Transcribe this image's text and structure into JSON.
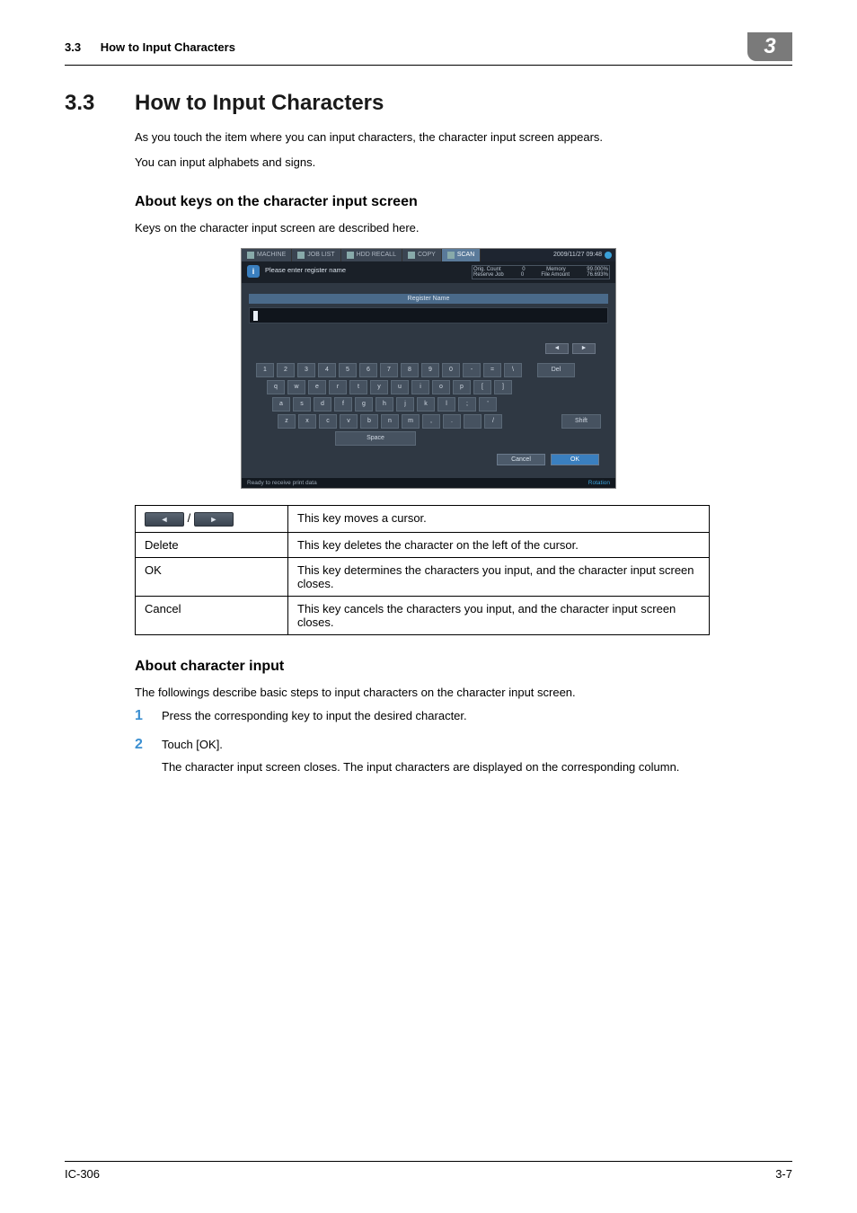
{
  "header": {
    "section_num": "3.3",
    "section_title": "How to Input Characters",
    "chapter_num": "3"
  },
  "heading": {
    "num": "3.3",
    "title": "How to Input Characters"
  },
  "intro": {
    "p1": "As you touch the item where you can input characters, the character input screen appears.",
    "p2": "You can input alphabets and signs."
  },
  "sub1": {
    "title": "About keys on the character input screen",
    "p1": "Keys on the character input screen are described here."
  },
  "device": {
    "tabs": {
      "machine": "MACHINE",
      "joblist": "JOB LIST",
      "hddrecall": "HDD RECALL",
      "copy": "COPY",
      "scan": "SCAN"
    },
    "datetime": "2009/11/27 09:48",
    "message": "Please enter register name",
    "status": {
      "orig_count_label": "Orig. Count",
      "orig_count_value": "0",
      "memory_label": "Memory",
      "memory_value": "99.000%",
      "reserve_label": "Reserve Job",
      "reserve_value": "0",
      "file_amount_label": "File Amount",
      "file_amount_value": "76.693%"
    },
    "field_title": "Register Name",
    "arrow_left": "◄",
    "arrow_right": "►",
    "row1": [
      "1",
      "2",
      "3",
      "4",
      "5",
      "6",
      "7",
      "8",
      "9",
      "0",
      "-",
      "=",
      "\\"
    ],
    "del_label": "Del",
    "row2": [
      "q",
      "w",
      "e",
      "r",
      "t",
      "y",
      "u",
      "i",
      "o",
      "p",
      "[",
      "]"
    ],
    "row3": [
      "a",
      "s",
      "d",
      "f",
      "g",
      "h",
      "j",
      "k",
      "l",
      ";",
      "'"
    ],
    "row4": [
      "z",
      "x",
      "c",
      "v",
      "b",
      "n",
      "m",
      ",",
      ".",
      "",
      "/"
    ],
    "shift_label": "Shift",
    "space_label": "Space",
    "cancel_label": "Cancel",
    "ok_label": "OK",
    "statusbar_left": "Ready to receive print data",
    "statusbar_right": "Rotation"
  },
  "key_table": {
    "r0": {
      "left_a": "◄",
      "left_sep": "/",
      "left_b": "►",
      "desc": "This key moves a cursor."
    },
    "r1": {
      "label": "Delete",
      "desc": "This key deletes the character on the left of the cursor."
    },
    "r2": {
      "label": "OK",
      "desc": "This key determines the characters you input, and the character input screen closes."
    },
    "r3": {
      "label": "Cancel",
      "desc": "This key cancels the characters you input, and the character input screen closes."
    }
  },
  "sub2": {
    "title": "About character input",
    "p1": "The followings describe basic steps to input characters on the character input screen."
  },
  "steps": {
    "s1": {
      "num": "1",
      "text": "Press the corresponding key to input the desired character."
    },
    "s2": {
      "num": "2",
      "text": "Touch [OK].",
      "sub": "The character input screen closes.  The input characters are displayed on the corresponding column."
    }
  },
  "footer": {
    "left": "IC-306",
    "right": "3-7"
  }
}
